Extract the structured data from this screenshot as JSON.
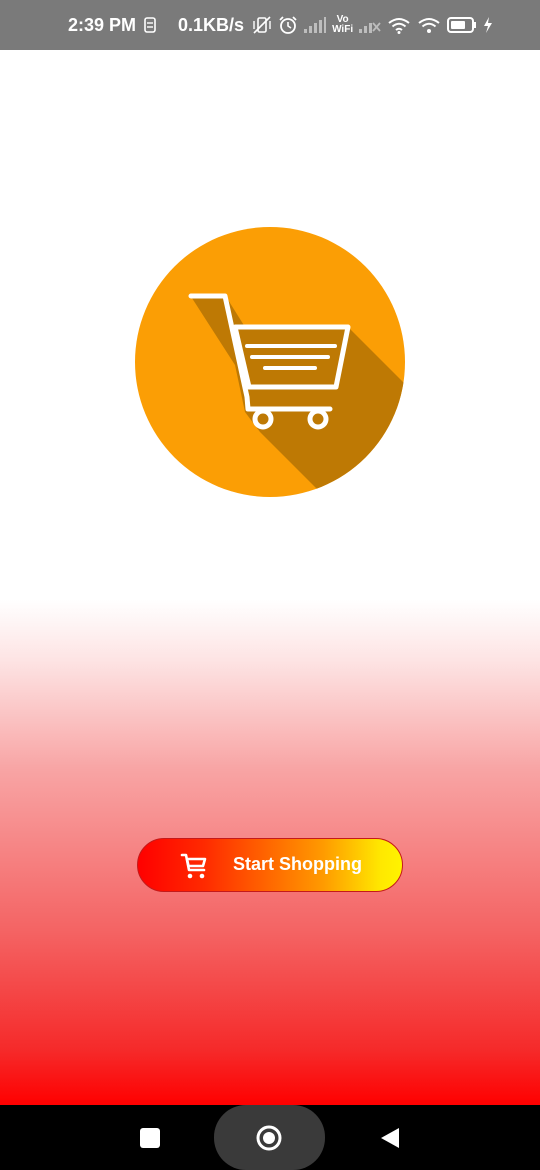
{
  "status_bar": {
    "time": "2:39 PM",
    "network_speed": "0.1KB/s",
    "vowifi_top": "Vo",
    "vowifi_bottom": "WiFi",
    "icons": [
      "sim-icon",
      "vibrate-off-icon",
      "alarm-icon",
      "signal-icon",
      "vowifi-icon",
      "signal-no-service-icon",
      "wifi-icon",
      "hotspot-icon",
      "battery-icon",
      "charging-icon"
    ]
  },
  "logo": {
    "icon": "shopping-cart-icon",
    "circle_color": "#fb9e05",
    "shadow_color": "#be7904"
  },
  "start_button": {
    "label": "Start Shopping",
    "icon": "cart-icon",
    "gradient": [
      "#ff0000",
      "#ff9a00",
      "#fff400"
    ]
  },
  "background": {
    "gradient": [
      "#ffffff",
      "#ff0000"
    ]
  },
  "nav_bar": {
    "icons": [
      "recent-apps-icon",
      "home-icon",
      "back-icon"
    ]
  }
}
